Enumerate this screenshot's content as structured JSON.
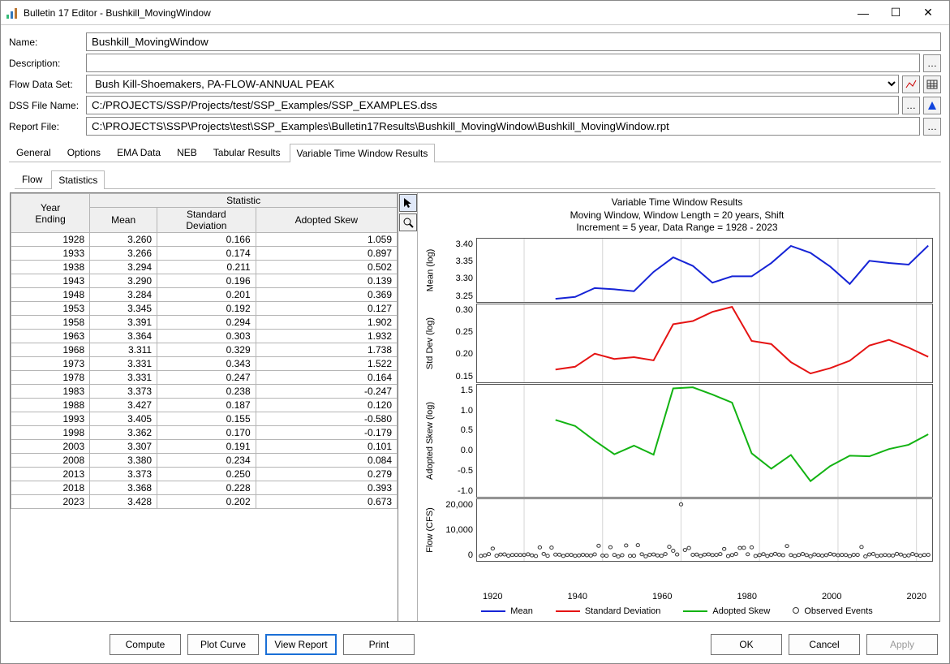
{
  "window": {
    "title": "Bulletin 17 Editor - Bushkill_MovingWindow"
  },
  "form": {
    "name_label": "Name:",
    "name": "Bushkill_MovingWindow",
    "desc_label": "Description:",
    "desc": "",
    "flowset_label": "Flow Data Set:",
    "flowset": "Bush Kill-Shoemakers, PA-FLOW-ANNUAL PEAK",
    "dss_label": "DSS File Name:",
    "dss": "C:/PROJECTS/SSP/Projects/test/SSP_Examples/SSP_EXAMPLES.dss",
    "report_label": "Report File:",
    "report": "C:\\PROJECTS\\SSP\\Projects\\test\\SSP_Examples\\Bulletin17Results\\Bushkill_MovingWindow\\Bushkill_MovingWindow.rpt"
  },
  "tabs": {
    "items": [
      "General",
      "Options",
      "EMA Data",
      "NEB",
      "Tabular Results",
      "Variable Time Window Results"
    ],
    "active_index": 5
  },
  "subtabs": {
    "items": [
      "Flow",
      "Statistics"
    ],
    "active_index": 1
  },
  "table": {
    "group_header_left": "Year\nEnding",
    "group_header_right": "Statistic",
    "cols": [
      "Mean",
      "Standard\nDeviation",
      "Adopted Skew"
    ],
    "rows": [
      {
        "year": "1928",
        "mean": "3.260",
        "sd": "0.166",
        "skew": "1.059"
      },
      {
        "year": "1933",
        "mean": "3.266",
        "sd": "0.174",
        "skew": "0.897"
      },
      {
        "year": "1938",
        "mean": "3.294",
        "sd": "0.211",
        "skew": "0.502"
      },
      {
        "year": "1943",
        "mean": "3.290",
        "sd": "0.196",
        "skew": "0.139"
      },
      {
        "year": "1948",
        "mean": "3.284",
        "sd": "0.201",
        "skew": "0.369"
      },
      {
        "year": "1953",
        "mean": "3.345",
        "sd": "0.192",
        "skew": "0.127"
      },
      {
        "year": "1958",
        "mean": "3.391",
        "sd": "0.294",
        "skew": "1.902"
      },
      {
        "year": "1963",
        "mean": "3.364",
        "sd": "0.303",
        "skew": "1.932"
      },
      {
        "year": "1968",
        "mean": "3.311",
        "sd": "0.329",
        "skew": "1.738"
      },
      {
        "year": "1973",
        "mean": "3.331",
        "sd": "0.343",
        "skew": "1.522"
      },
      {
        "year": "1978",
        "mean": "3.331",
        "sd": "0.247",
        "skew": "0.164"
      },
      {
        "year": "1983",
        "mean": "3.373",
        "sd": "0.238",
        "skew": "-0.247"
      },
      {
        "year": "1988",
        "mean": "3.427",
        "sd": "0.187",
        "skew": "0.120"
      },
      {
        "year": "1993",
        "mean": "3.405",
        "sd": "0.155",
        "skew": "-0.580"
      },
      {
        "year": "1998",
        "mean": "3.362",
        "sd": "0.170",
        "skew": "-0.179"
      },
      {
        "year": "2003",
        "mean": "3.307",
        "sd": "0.191",
        "skew": "0.101"
      },
      {
        "year": "2008",
        "mean": "3.380",
        "sd": "0.234",
        "skew": "0.084"
      },
      {
        "year": "2013",
        "mean": "3.373",
        "sd": "0.250",
        "skew": "0.279"
      },
      {
        "year": "2018",
        "mean": "3.368",
        "sd": "0.228",
        "skew": "0.393"
      },
      {
        "year": "2023",
        "mean": "3.428",
        "sd": "0.202",
        "skew": "0.673"
      }
    ]
  },
  "chart_data": [
    {
      "type": "line",
      "title": "Variable Time Window Results",
      "subtitle1": "Moving Window, Window Length = 20 years, Shift",
      "subtitle2": "Increment = 5 year, Data Range = 1928 - 2023",
      "panels": [
        {
          "name": "Mean (log)",
          "color": "#1624d6",
          "ylim": [
            3.25,
            3.45
          ],
          "yticks": [
            "3.40",
            "3.35",
            "3.30",
            "3.25"
          ],
          "x": [
            1928,
            1933,
            1938,
            1943,
            1948,
            1953,
            1958,
            1963,
            1968,
            1973,
            1978,
            1983,
            1988,
            1993,
            1998,
            2003,
            2008,
            2013,
            2018,
            2023
          ],
          "y": [
            3.26,
            3.266,
            3.294,
            3.29,
            3.284,
            3.345,
            3.391,
            3.364,
            3.311,
            3.331,
            3.331,
            3.373,
            3.427,
            3.405,
            3.362,
            3.307,
            3.38,
            3.373,
            3.368,
            3.428
          ]
        },
        {
          "name": "Std Dev (log)",
          "color": "#e51313",
          "ylim": [
            0.13,
            0.35
          ],
          "yticks": [
            "0.30",
            "0.25",
            "0.20",
            "0.15"
          ],
          "x": [
            1928,
            1933,
            1938,
            1943,
            1948,
            1953,
            1958,
            1963,
            1968,
            1973,
            1978,
            1983,
            1988,
            1993,
            1998,
            2003,
            2008,
            2013,
            2018,
            2023
          ],
          "y": [
            0.166,
            0.174,
            0.211,
            0.196,
            0.201,
            0.192,
            0.294,
            0.303,
            0.329,
            0.343,
            0.247,
            0.238,
            0.187,
            0.155,
            0.17,
            0.191,
            0.234,
            0.25,
            0.228,
            0.202
          ]
        },
        {
          "name": "Adopted Skew (log)",
          "color": "#13b313",
          "ylim": [
            -1.0,
            2.0
          ],
          "yticks": [
            "1.5",
            "1.0",
            "0.5",
            "0.0",
            "-0.5",
            "-1.0"
          ],
          "x": [
            1928,
            1933,
            1938,
            1943,
            1948,
            1953,
            1958,
            1963,
            1968,
            1973,
            1978,
            1983,
            1988,
            1993,
            1998,
            2003,
            2008,
            2013,
            2018,
            2023
          ],
          "y": [
            1.059,
            0.897,
            0.502,
            0.139,
            0.369,
            0.127,
            1.902,
            1.932,
            1.738,
            1.522,
            0.164,
            -0.247,
            0.12,
            -0.58,
            -0.179,
            0.101,
            0.084,
            0.279,
            0.393,
            0.673
          ]
        },
        {
          "name": "Flow (CFS)",
          "color": "#000",
          "type": "scatter",
          "ylim": [
            0,
            24000
          ],
          "yticks": [
            "20,000",
            "10,000",
            "0"
          ],
          "x_range": [
            1908,
            2024
          ],
          "sample_points": 115
        }
      ],
      "xlabel": "",
      "xlim": [
        1908,
        2024
      ],
      "xticks": [
        "1920",
        "1940",
        "1960",
        "1980",
        "2000",
        "2020"
      ],
      "legend": [
        {
          "label": "Mean",
          "color": "#1624d6"
        },
        {
          "label": "Standard Deviation",
          "color": "#e51313"
        },
        {
          "label": "Adopted Skew",
          "color": "#13b313"
        },
        {
          "label": "Observed Events",
          "marker": "o"
        }
      ]
    }
  ],
  "buttons": {
    "compute": "Compute",
    "plot": "Plot Curve",
    "view": "View Report",
    "print": "Print",
    "ok": "OK",
    "cancel": "Cancel",
    "apply": "Apply"
  }
}
